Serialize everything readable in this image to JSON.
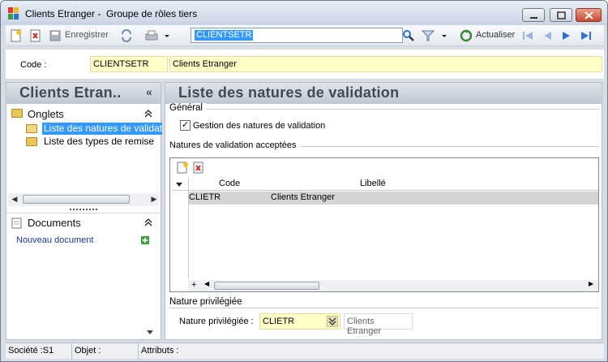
{
  "window": {
    "title": "Clients Etranger -  Groupe de rôles tiers"
  },
  "toolbar": {
    "save_label": "Enregistrer",
    "search_value": "CLIENTSETR",
    "refresh_label": "Actualiser"
  },
  "code_row": {
    "label": "Code :",
    "code": "CLIENTSETR",
    "description": "Clients Etranger"
  },
  "left_panel": {
    "title": "Clients Etran..",
    "collapse_glyph": "«",
    "tabs_section": "Onglets",
    "tabs": [
      {
        "label": "Liste des natures de validation",
        "selected": true
      },
      {
        "label": "Liste des types de remise",
        "selected": false
      }
    ],
    "documents_section": "Documents",
    "new_document": "Nouveau document"
  },
  "main": {
    "title": "Liste des natures de validation",
    "general_group": "Général",
    "manage_checkbox_label": "Gestion des natures de validation",
    "manage_checked": true,
    "accepted_group": "Natures de validation acceptées",
    "grid": {
      "columns": [
        "Code",
        "Libellé"
      ],
      "rows": [
        {
          "code": "CLIETR",
          "label": "Clients Etranger"
        }
      ]
    },
    "privileged_group": "Nature privilégiée",
    "privileged_label": "Nature privilégiée :",
    "privileged_code": "CLIETR",
    "privileged_desc": "Clients Etranger"
  },
  "status_bar": {
    "company": "Société :S1",
    "object": "Objet :",
    "attributes": "Attributs :"
  },
  "colors": {
    "selection": "#3399ff",
    "required_field": "#ffffc8",
    "header_text": "#404a55",
    "nav_arrow": "#2f6fd6"
  }
}
